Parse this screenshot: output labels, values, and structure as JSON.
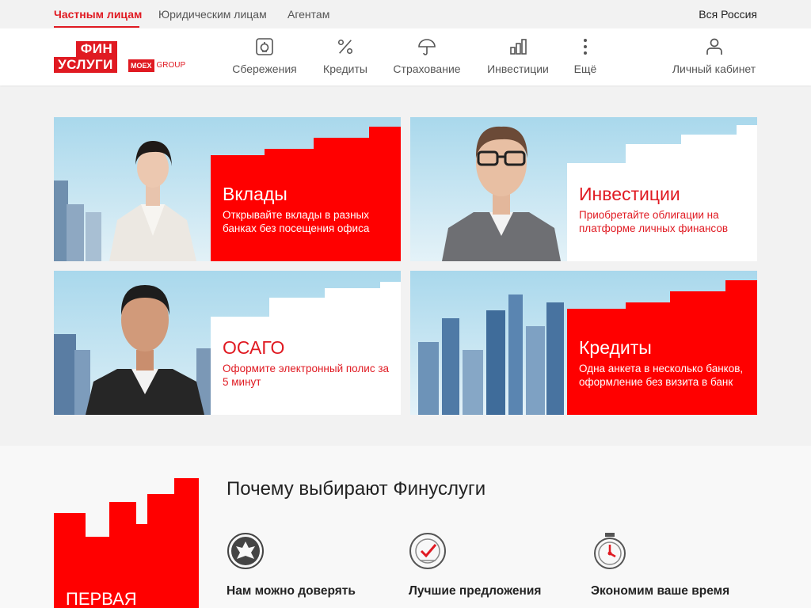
{
  "segments": {
    "individuals": "Частным лицам",
    "legal": "Юридическим лицам",
    "agents": "Агентам"
  },
  "region": "Вся Россия",
  "logo": {
    "top": "ФИН",
    "bottom": "УСЛУГИ",
    "moex": "MOEX",
    "group": "GROUP"
  },
  "nav": {
    "savings": "Сбережения",
    "credits": "Кредиты",
    "insurance": "Страхование",
    "investments": "Инвестиции",
    "more": "Ещё",
    "account": "Личный кабинет"
  },
  "cards": {
    "deposits": {
      "title": "Вклады",
      "text": "Открывайте вклады в разных банках без посещения офиса"
    },
    "investments": {
      "title": "Инвестиции",
      "text": "Приобретайте облигации на платформе личных финансов"
    },
    "osago": {
      "title": "ОСАГО",
      "text": "Оформите электронный полис за 5 минут"
    },
    "credits": {
      "title": "Кредиты",
      "text": "Одна анкета в несколько банков, оформление без визита в банк"
    }
  },
  "why": {
    "title": "Почему выбирают Финуслуги",
    "first": "ПЕРВАЯ",
    "features": {
      "trust": "Нам можно доверять",
      "best": "Лучшие предложения",
      "time": "Экономим ваше время"
    }
  },
  "colors": {
    "brand_red": "#e01a22",
    "text": "#222222",
    "muted": "#555555"
  }
}
